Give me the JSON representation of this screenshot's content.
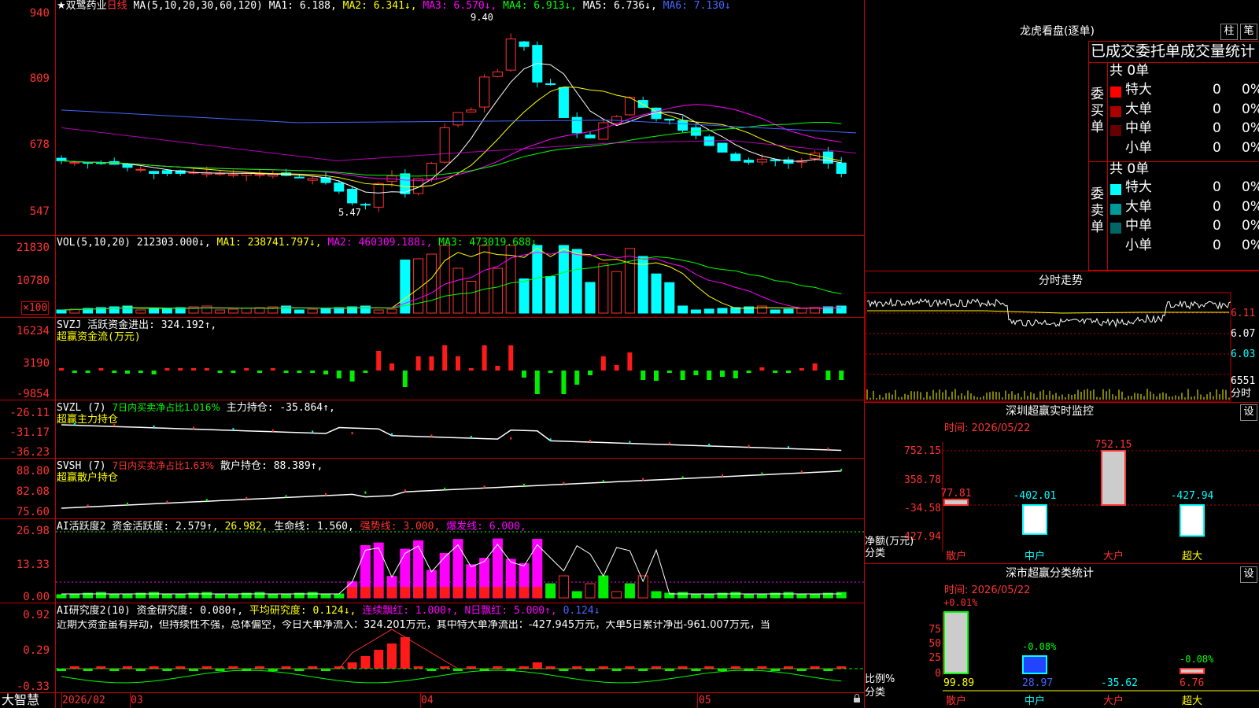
{
  "app_name": "大智慧",
  "stock": {
    "name": "★双鹭药业",
    "period": "日线"
  },
  "main": {
    "ma_label": "MA(5,10,20,30,60,120)",
    "ma1": "MA1: 6.188,",
    "ma2": "MA2: 6.341↓,",
    "ma3": "MA3: 6.570↓,",
    "ma4": "MA4: 6.913↓,",
    "ma5": "MA5: 6.736↓,",
    "ma6": "MA6: 7.130↓",
    "high_mark": "9.40",
    "low_mark": "5.47",
    "y_ticks": [
      "940",
      "809",
      "678",
      "547"
    ]
  },
  "vol": {
    "label": "VOL(5,10,20)",
    "value": "212303.000↓,",
    "ma1": "MA1: 238741.797↓,",
    "ma2": "MA2: 460309.188↓,",
    "ma3": "MA3: 473019.688↓",
    "y_ticks": [
      "21830",
      "10780",
      "×100"
    ]
  },
  "svzj": {
    "label": "SVZJ",
    "text": "活跃资金进出: 324.192↑,",
    "sub": "超赢资金流(万元)",
    "y_ticks": [
      "16234",
      "3190",
      "-9854"
    ]
  },
  "svzl": {
    "label": "SVZL (7)",
    "ratio": "7日内买卖净占比1.016%",
    "text": "主力持仓: -35.864↑,",
    "sub": "超赢主力持仓",
    "y_ticks": [
      "-26.11",
      "-31.17",
      "-36.23"
    ]
  },
  "svsh": {
    "label": "SVSH (7)",
    "ratio": "7日内买卖净占比1.63%",
    "text": "散户持仓: 88.389↑,",
    "sub": "超赢散户持仓",
    "y_ticks": [
      "88.80",
      "82.08",
      "75.60"
    ]
  },
  "ai1": {
    "label": "AI活跃度2",
    "a": "资金活跃度: 2.579↑,",
    "b": "26.982,",
    "c": "生命线: 1.560,",
    "d": "强势线: 3.000,",
    "e": "爆发线: 6.000,",
    "y_ticks": [
      "26.98",
      "13.33",
      "0.00"
    ]
  },
  "ai2": {
    "label": "AI研究度2(10)",
    "a": "资金研究度: 0.080↑,",
    "b": "平均研究度: 0.124↓,",
    "c": "连续飘红: 1.000↑,",
    "d": "N日飘红: 5.000↑,",
    "e": "0.124↓",
    "desc": "近期大资金虽有异动，但持续性不强，总体偏空，今日大单净流入：324.201万元，其中特大单净流出：-427.945万元，大单5日累计净出-961.007万元，当",
    "y_ticks": [
      "0.92",
      "0.29",
      "-0.33"
    ]
  },
  "xaxis": {
    "labels": [
      "2026/02",
      "03",
      "04",
      "05"
    ]
  },
  "longhu": {
    "title": "龙虎看盘(逐单)",
    "btn1": "柱",
    "btn2": "笔",
    "subtitle": "已成交委托单成交量统计",
    "buy": {
      "label": "委买单",
      "total": "共 0单",
      "rows": [
        {
          "name": "特大",
          "n": "0",
          "p": "0%",
          "color": "#ff0000"
        },
        {
          "name": "大单",
          "n": "0",
          "p": "0%",
          "color": "#aa0000"
        },
        {
          "name": "中单",
          "n": "0",
          "p": "0%",
          "color": "#660000"
        },
        {
          "name": "小单",
          "n": "0",
          "p": "0%",
          "color": "#000000"
        }
      ]
    },
    "sell": {
      "label": "委卖单",
      "total": "共 0单",
      "rows": [
        {
          "name": "特大",
          "n": "0",
          "p": "0%",
          "color": "#00ffff"
        },
        {
          "name": "大单",
          "n": "0",
          "p": "0%",
          "color": "#009999"
        },
        {
          "name": "中单",
          "n": "0",
          "p": "0%",
          "color": "#006666"
        },
        {
          "name": "小单",
          "n": "0",
          "p": "0%",
          "color": "#000000"
        }
      ]
    }
  },
  "intraday": {
    "title": "分时走势",
    "prices": [
      "6.11",
      "6.07",
      "6.03"
    ],
    "vol": "6551",
    "vol_label": "分时"
  },
  "sz_monitor": {
    "title": "深圳超赢实时监控",
    "btn": "设",
    "time": "时间: 2026/05/22",
    "y_ticks": [
      "752.15",
      "358.78",
      "-34.58",
      "-427.94"
    ],
    "ylabel": "净额(万元)",
    "xlabel": "分类",
    "cats": [
      "散户",
      "中户",
      "大户",
      "超大"
    ],
    "values": [
      77.81,
      -402.01,
      752.15,
      -427.94
    ],
    "value_labels": [
      "77.81",
      "-402.01",
      "752.15",
      "-427.94"
    ]
  },
  "sz_class": {
    "title": "深市超赢分类统计",
    "btn": "设",
    "time": "时间: 2026/05/22",
    "y_ticks": [
      "75",
      "50",
      "25",
      "0"
    ],
    "ylabel": "比例%",
    "xlabel": "分类",
    "cats": [
      "散户",
      "中户",
      "大户",
      "超大"
    ],
    "change_labels": [
      "+0.01%",
      "-0.08%",
      "",
      "-0.08%"
    ],
    "values": [
      "99.89",
      "28.97",
      "-35.62",
      "6.76"
    ]
  }
}
